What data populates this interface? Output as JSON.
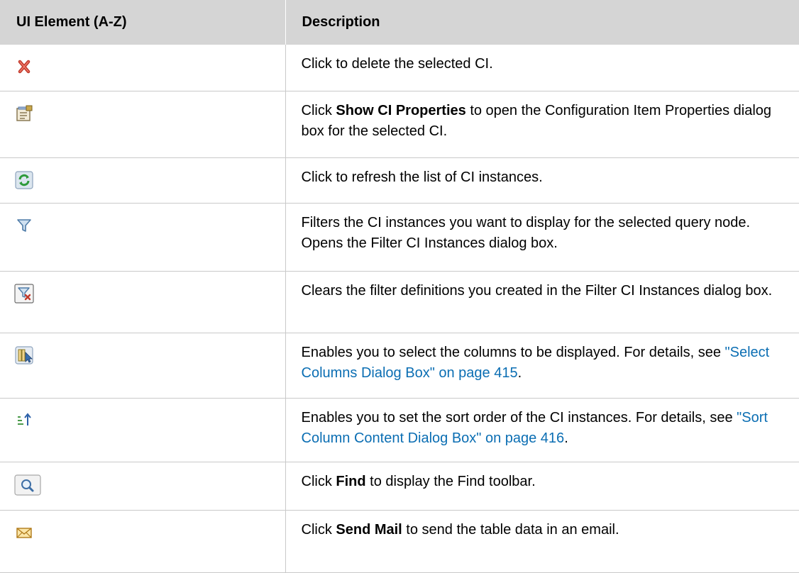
{
  "table": {
    "headers": {
      "element": "UI Element (A-Z)",
      "description": "Description"
    },
    "rows": [
      {
        "icon": "delete-icon",
        "pre": "Click to delete the selected CI.",
        "bold": "",
        "post": "",
        "link": "",
        "tail": ""
      },
      {
        "icon": "properties-icon",
        "pre": "Click ",
        "bold": "Show CI Properties",
        "post": " to open the Configuration Item Properties dialog box for the selected CI.",
        "link": "",
        "tail": ""
      },
      {
        "icon": "refresh-icon",
        "pre": "Click to refresh the list of CI instances.",
        "bold": "",
        "post": "",
        "link": "",
        "tail": ""
      },
      {
        "icon": "filter-icon",
        "pre": "Filters the CI instances you want to display for the selected query node. Opens the Filter CI Instances dialog box.",
        "bold": "",
        "post": "",
        "link": "",
        "tail": ""
      },
      {
        "icon": "clear-filter-icon",
        "pre": "Clears the filter definitions you created in the Filter CI Instances dialog box.",
        "bold": "",
        "post": "",
        "link": "",
        "tail": ""
      },
      {
        "icon": "select-columns-icon",
        "pre": "Enables you to select the columns to be displayed. For details, see ",
        "bold": "",
        "post": "",
        "link": "\"Select Columns Dialog Box\" on page 415",
        "tail": "."
      },
      {
        "icon": "sort-icon",
        "pre": "Enables you to set the sort order of the CI instances. For details, see ",
        "bold": "",
        "post": "",
        "link": "\"Sort Column Content Dialog Box\" on page 416",
        "tail": "."
      },
      {
        "icon": "find-icon",
        "pre": "Click ",
        "bold": "Find",
        "post": " to display the Find toolbar.",
        "link": "",
        "tail": ""
      },
      {
        "icon": "mail-icon",
        "pre": "Click ",
        "bold": "Send Mail",
        "post": " to send the table data in an email.",
        "link": "",
        "tail": ""
      }
    ]
  }
}
